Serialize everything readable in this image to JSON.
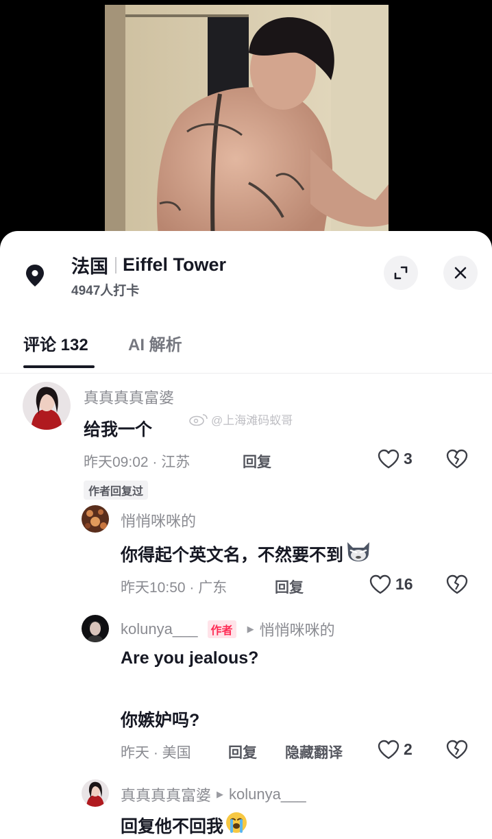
{
  "location": {
    "title_cn": "法国",
    "title_en": "Eiffel Tower",
    "checkins": "4947人打卡",
    "icon": "location-pin-icon"
  },
  "tabs": [
    {
      "label": "评论 132",
      "active": true
    },
    {
      "label": "AI 解析",
      "active": false
    }
  ],
  "watermark": "@上海滩码蚁哥",
  "comments": [
    {
      "user": "真真真真富婆",
      "text": "给我一个",
      "meta": "昨天09:02 · 江苏",
      "reply_label": "回复",
      "likes": "3",
      "chip": "作者回复过"
    },
    {
      "user": "悄悄咪咪的",
      "text": "你得起个英文名，不然要不到",
      "meta": "昨天10:50 · 广东",
      "reply_label": "回复",
      "likes": "16"
    },
    {
      "user": "kolunya___",
      "badge": "作者",
      "reply_to": "悄悄咪咪的",
      "text_line1": "Are you jealous?",
      "text_line2": "你嫉妒吗?",
      "meta": "昨天 · 美国",
      "reply_label": "回复",
      "hide_translation": "隐藏翻译",
      "likes": "2"
    },
    {
      "user": "真真真真富婆",
      "reply_to": "kolunya___",
      "text": "回复他不回我"
    }
  ],
  "accent_color": "#fe2c55"
}
